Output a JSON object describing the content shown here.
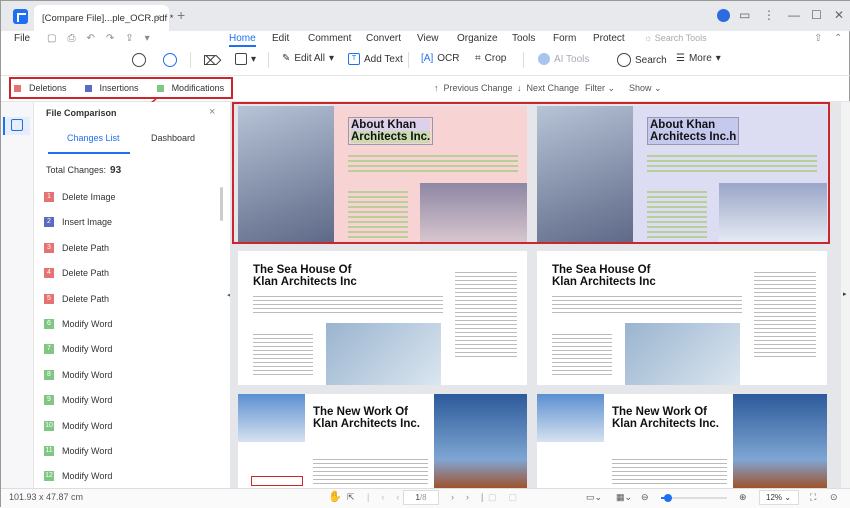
{
  "window": {
    "tab_title": "[Compare File]...ple_OCR.pdf *",
    "close": "×",
    "new_tab": "+",
    "minimize": "—",
    "maximize": "☐",
    "close_window": "✕"
  },
  "menu": {
    "file": "File",
    "tabs": [
      "Home",
      "Edit",
      "Comment",
      "Convert",
      "View",
      "Organize",
      "Tools",
      "Form",
      "Protect"
    ],
    "search_tools": "Search Tools"
  },
  "toolbar": {
    "edit_all": "Edit All",
    "add_text": "Add Text",
    "ocr": "OCR",
    "crop": "Crop",
    "ai_tools": "AI Tools",
    "search": "Search",
    "more": "More"
  },
  "compare": {
    "legend": [
      {
        "label": "Deletions",
        "color": "#e57373"
      },
      {
        "label": "Insertions",
        "color": "#5c6bc0"
      },
      {
        "label": "Modifications",
        "color": "#81c784"
      }
    ],
    "previous": "Previous Change",
    "next": "Next Change",
    "filter": "Filter",
    "show": "Show"
  },
  "panel": {
    "title": "File Comparison",
    "close": "×",
    "tabs": [
      "Changes List",
      "Dashboard"
    ],
    "total_label": "Total Changes:",
    "total": "93",
    "items": [
      {
        "n": "1",
        "label": "Delete Image",
        "color": "#e57373"
      },
      {
        "n": "2",
        "label": "Insert Image",
        "color": "#5c6bc0"
      },
      {
        "n": "3",
        "label": "Delete Path",
        "color": "#e57373"
      },
      {
        "n": "4",
        "label": "Delete Path",
        "color": "#e57373"
      },
      {
        "n": "5",
        "label": "Delete Path",
        "color": "#e57373"
      },
      {
        "n": "6",
        "label": "Modify Word",
        "color": "#81c784"
      },
      {
        "n": "7",
        "label": "Modify Word",
        "color": "#81c784"
      },
      {
        "n": "8",
        "label": "Modify Word",
        "color": "#81c784"
      },
      {
        "n": "9",
        "label": "Modify Word",
        "color": "#81c784"
      },
      {
        "n": "10",
        "label": "Modify Word",
        "color": "#81c784"
      },
      {
        "n": "11",
        "label": "Modify Word",
        "color": "#81c784"
      },
      {
        "n": "12",
        "label": "Modify Word",
        "color": "#81c784"
      }
    ]
  },
  "pages": {
    "p1_title_a": "About Khan",
    "p1_title_b": "Architects Inc.",
    "p1r_title_a": "About Khan",
    "p1r_title_b": "Architects Inc.h",
    "p2_title_a": "The Sea House Of",
    "p2_title_b": "Klan Architects Inc",
    "p3_title_a": "The New Work Of",
    "p3_title_b": "Klan Architects Inc."
  },
  "status": {
    "dimensions": "101.93 x 47.87 cm",
    "page": "1",
    "page_total": "/8",
    "zoom": "12%",
    "zoom_level": 0.12
  }
}
